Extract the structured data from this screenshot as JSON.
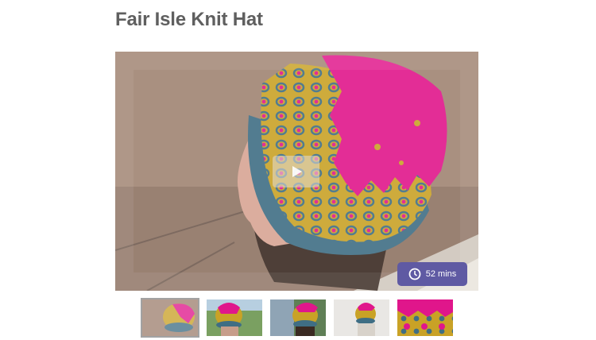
{
  "page": {
    "title": "Fair Isle Knit Hat"
  },
  "video": {
    "duration_label": "52 mins",
    "play_icon": "play-icon",
    "clock_icon": "clock-icon"
  },
  "thumbnails": [
    {
      "active": true
    },
    {
      "active": false
    },
    {
      "active": false
    },
    {
      "active": false
    },
    {
      "active": false
    }
  ],
  "colors": {
    "title": "#5f5f5f",
    "badge": "#5f5aa3",
    "hat_magenta": "#e0168b",
    "hat_mustard": "#c9a226",
    "hat_teal": "#3f6e84"
  }
}
